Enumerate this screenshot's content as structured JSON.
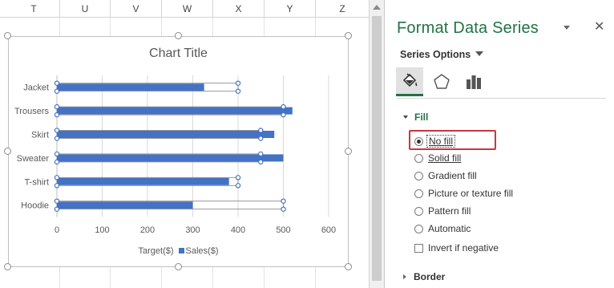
{
  "spreadsheet": {
    "columns": [
      "T",
      "U",
      "V",
      "W",
      "X",
      "Y",
      "Z"
    ]
  },
  "chart": {
    "title": "Chart Title",
    "legend": [
      "Target($)",
      "Sales($)"
    ],
    "chart_data": {
      "type": "bar",
      "title": "Chart Title",
      "categories": [
        "Jacket",
        "Trousers",
        "Skirt",
        "Sweater",
        "T-shirt",
        "Hoodie"
      ],
      "series": [
        {
          "name": "Target($)",
          "values": [
            400,
            500,
            450,
            450,
            400,
            500
          ],
          "fill": "none"
        },
        {
          "name": "Sales($)",
          "values": [
            325,
            520,
            480,
            500,
            380,
            300
          ],
          "color": "#4472c4"
        }
      ],
      "xlim": [
        0,
        600
      ],
      "xticks": [
        0,
        100,
        200,
        300,
        400,
        500,
        600
      ],
      "grid": true,
      "legend_position": "bottom"
    }
  },
  "pane": {
    "title": "Format Data Series",
    "close_glyph": "✕",
    "series_options_label": "Series Options",
    "tabs": [
      {
        "name": "fill-line",
        "active": true
      },
      {
        "name": "effects",
        "active": false
      },
      {
        "name": "series-options",
        "active": false
      }
    ],
    "fill_section": "Fill",
    "fill_options": [
      {
        "label": "No fill",
        "checked": true
      },
      {
        "label": "Solid fill",
        "checked": false
      },
      {
        "label": "Gradient fill",
        "checked": false
      },
      {
        "label": "Picture or texture fill",
        "checked": false
      },
      {
        "label": "Pattern fill",
        "checked": false
      },
      {
        "label": "Automatic",
        "checked": false
      }
    ],
    "invert_label": "Invert if negative",
    "border_section": "Border",
    "accent_color": "#217346",
    "highlight_color": "#c8373f"
  }
}
